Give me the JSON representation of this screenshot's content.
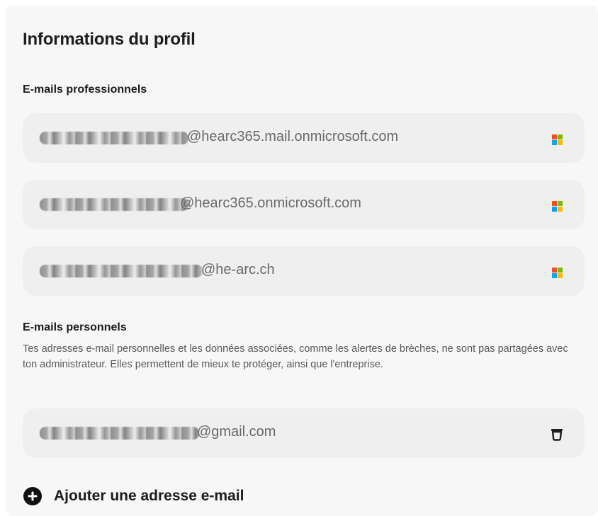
{
  "profile": {
    "title": "Informations du profil",
    "work_section": {
      "label": "E-mails professionnels",
      "emails": [
        {
          "domain": "@hearc365.mail.onmicrosoft.com",
          "provider_icon": "microsoft-icon"
        },
        {
          "domain": "@hearc365.onmicrosoft.com",
          "provider_icon": "microsoft-icon"
        },
        {
          "domain": "@he-arc.ch",
          "provider_icon": "microsoft-icon"
        }
      ]
    },
    "personal_section": {
      "label": "E-mails personnels",
      "description": "Tes adresses e-mail personnelles et les données associées, comme les alertes de brèches, ne sont pas partagées avec ton administrateur. Elles permettent de mieux te protéger, ainsi que l'entreprise.",
      "emails": [
        {
          "domain": "@gmail.com",
          "action_icon": "trash-icon"
        }
      ]
    },
    "add_email_label": "Ajouter une adresse e-mail"
  },
  "colors": {
    "ms_red": "#f25022",
    "ms_green": "#7fba00",
    "ms_blue": "#00a4ef",
    "ms_yellow": "#ffb900",
    "panel_bg": "#f7f7f7",
    "row_bg": "#efefef"
  }
}
